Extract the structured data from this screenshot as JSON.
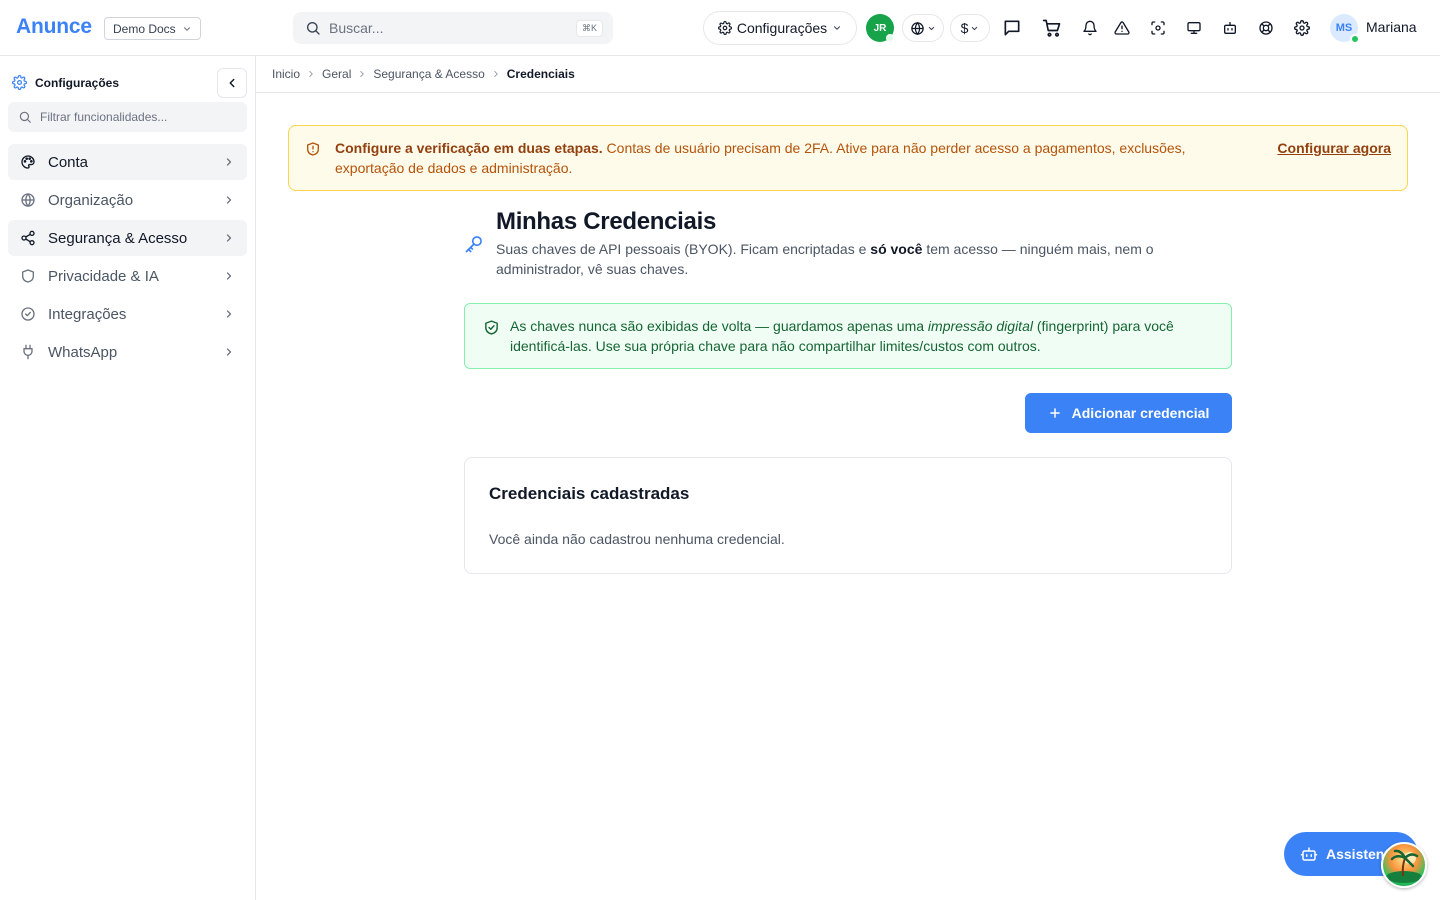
{
  "header": {
    "brand": "Anunce",
    "workspace": "Demo Docs",
    "search_placeholder": "Buscar...",
    "search_shortcut": "⌘K",
    "settings_label": "Configurações",
    "org_initials": "JR",
    "currency_symbol": "$",
    "user_initials": "MS",
    "user_name": "Mariana"
  },
  "sidebar": {
    "title": "Configurações",
    "filter_placeholder": "Filtrar funcionalidades...",
    "items": [
      {
        "label": "Conta",
        "icon": "palette-icon",
        "active": true
      },
      {
        "label": "Organização",
        "icon": "globe-icon",
        "active": false
      },
      {
        "label": "Segurança & Acesso",
        "icon": "share-nodes-icon",
        "active": true
      },
      {
        "label": "Privacidade & IA",
        "icon": "shield-icon",
        "active": false
      },
      {
        "label": "Integrações",
        "icon": "check-circle-icon",
        "active": false
      },
      {
        "label": "WhatsApp",
        "icon": "plug-icon",
        "active": false
      }
    ]
  },
  "breadcrumb": [
    "Inicio",
    "Geral",
    "Segurança & Acesso",
    "Credenciais"
  ],
  "alert_2fa": {
    "title": "Configure a verificação em duas etapas.",
    "message": " Contas de usuário precisam de 2FA. Ative para não perder acesso a pagamentos, exclusões, exportação de dados e administração.",
    "action": "Configurar agora"
  },
  "page": {
    "title": "Minhas Credenciais",
    "desc_before": "Suas chaves de API pessoais (BYOK). Ficam encriptadas e ",
    "desc_bold": "só você",
    "desc_after": " tem acesso — ninguém mais, nem o administrador, vê suas chaves."
  },
  "info": {
    "before": "As chaves nunca são exibidas de volta — guardamos apenas uma ",
    "italic": "impressão digital",
    "after": " (fingerprint) para você identificá-las. Use sua própria chave para não compartilhar limites/custos com outros."
  },
  "add_button": "Adicionar credencial",
  "credentials_card": {
    "title": "Credenciais cadastradas",
    "empty": "Você ainda não cadastrou nenhuma credencial."
  },
  "assistant_label": "Assistente",
  "colors": {
    "primary": "#3b82f6",
    "warning_bg": "#fffbeb",
    "warning_text": "#b45309",
    "success_bg": "#f0fdf4",
    "success_text": "#166534"
  }
}
